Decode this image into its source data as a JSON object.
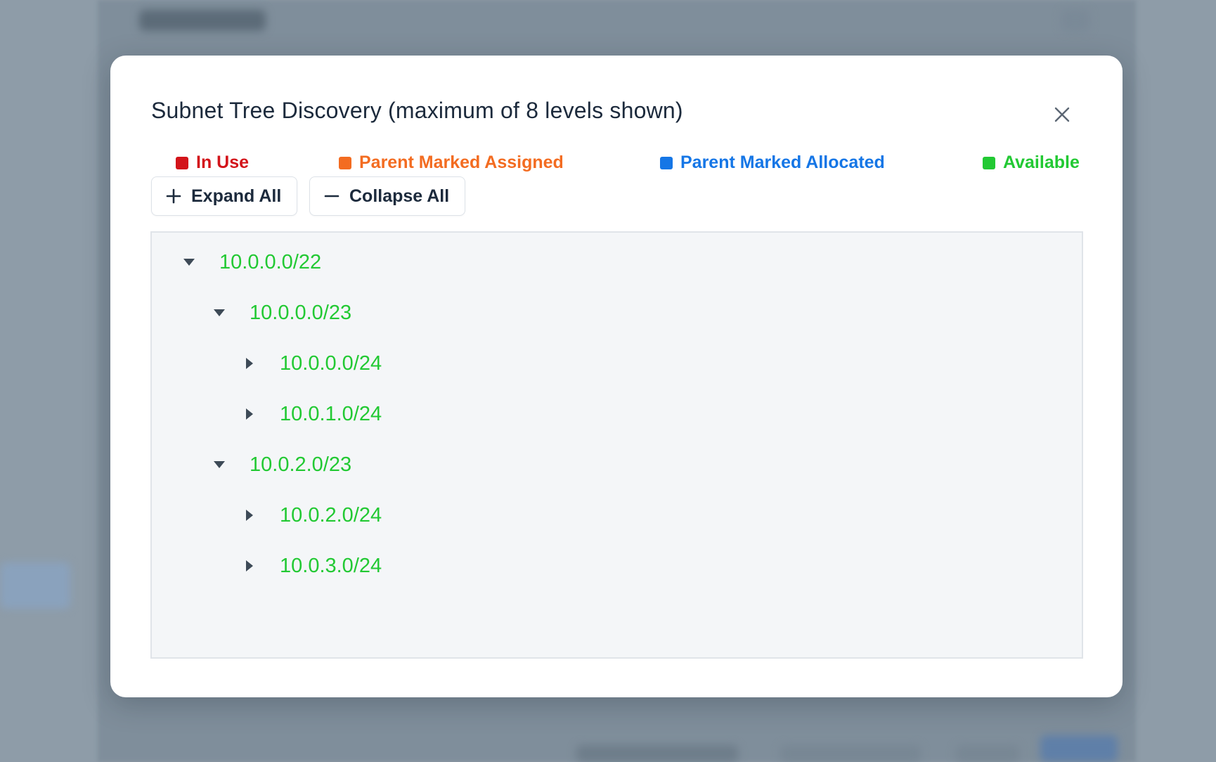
{
  "dialog": {
    "title": "Subnet Tree Discovery (maximum of 8 levels shown)"
  },
  "legend": [
    {
      "label": "In Use",
      "color": "#d3141a"
    },
    {
      "label": "Parent Marked Assigned",
      "color": "#f36c21"
    },
    {
      "label": "Parent Marked Allocated",
      "color": "#1576e6"
    },
    {
      "label": "Available",
      "color": "#22c933"
    }
  ],
  "toolbar": {
    "expand_all_label": "Expand All",
    "collapse_all_label": "Collapse All"
  },
  "tree": [
    {
      "label": "10.0.0.0/22",
      "level": 0,
      "expanded": true,
      "status": "Available"
    },
    {
      "label": "10.0.0.0/23",
      "level": 1,
      "expanded": true,
      "status": "Available"
    },
    {
      "label": "10.0.0.0/24",
      "level": 2,
      "expanded": false,
      "status": "Available"
    },
    {
      "label": "10.0.1.0/24",
      "level": 2,
      "expanded": false,
      "status": "Available"
    },
    {
      "label": "10.0.2.0/23",
      "level": 1,
      "expanded": true,
      "status": "Available"
    },
    {
      "label": "10.0.2.0/24",
      "level": 2,
      "expanded": false,
      "status": "Available"
    },
    {
      "label": "10.0.3.0/24",
      "level": 2,
      "expanded": false,
      "status": "Available"
    }
  ],
  "icons": {
    "close": "close-icon",
    "expand": "plus-icon",
    "collapse": "minus-icon",
    "expanded_node": "caret-down-icon",
    "collapsed_node": "caret-right-icon"
  }
}
